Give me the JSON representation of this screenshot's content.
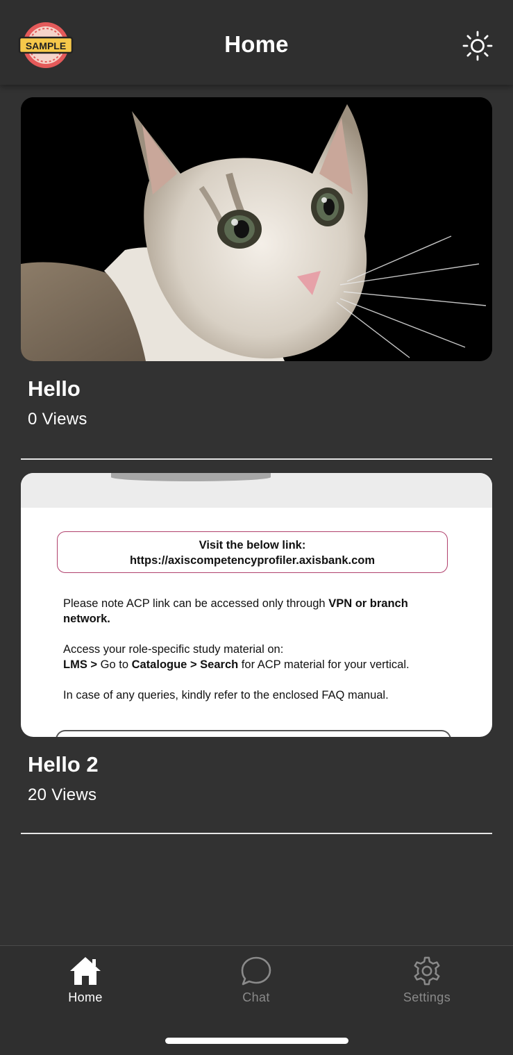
{
  "header": {
    "logo_text": "SAMPLE",
    "title": "Home",
    "theme_icon": "sun-icon"
  },
  "posts": [
    {
      "title": "Hello",
      "views": "0 Views",
      "image": "cat-photo"
    },
    {
      "title": "Hello 2",
      "views": "20 Views",
      "image": "document-screenshot",
      "document": {
        "link_heading": "Visit the below link:",
        "link_url": "https://axiscompetencyprofiler.axisbank.com",
        "note_pre": "Please note ACP link can be accessed only through ",
        "note_bold": "VPN or branch network.",
        "access_line": "Access your role-specific study material on:",
        "path_lms": "LMS >",
        "path_goto": " Go to ",
        "path_catalogue": "Catalogue",
        "path_sep": " > ",
        "path_search": "Search",
        "path_rest": " for ACP material for your vertical.",
        "queries_line": "In case of any queries, kindly refer to the enclosed FAQ manual."
      }
    }
  ],
  "tabbar": {
    "tabs": [
      {
        "label": "Home",
        "icon": "home-icon",
        "active": true
      },
      {
        "label": "Chat",
        "icon": "chat-bubble-icon",
        "active": false
      },
      {
        "label": "Settings",
        "icon": "gear-icon",
        "active": false
      }
    ]
  },
  "colors": {
    "background": "#323232",
    "header": "#2f2f2f",
    "active_tab": "#ffffff",
    "inactive_tab": "#8a8a8a"
  }
}
